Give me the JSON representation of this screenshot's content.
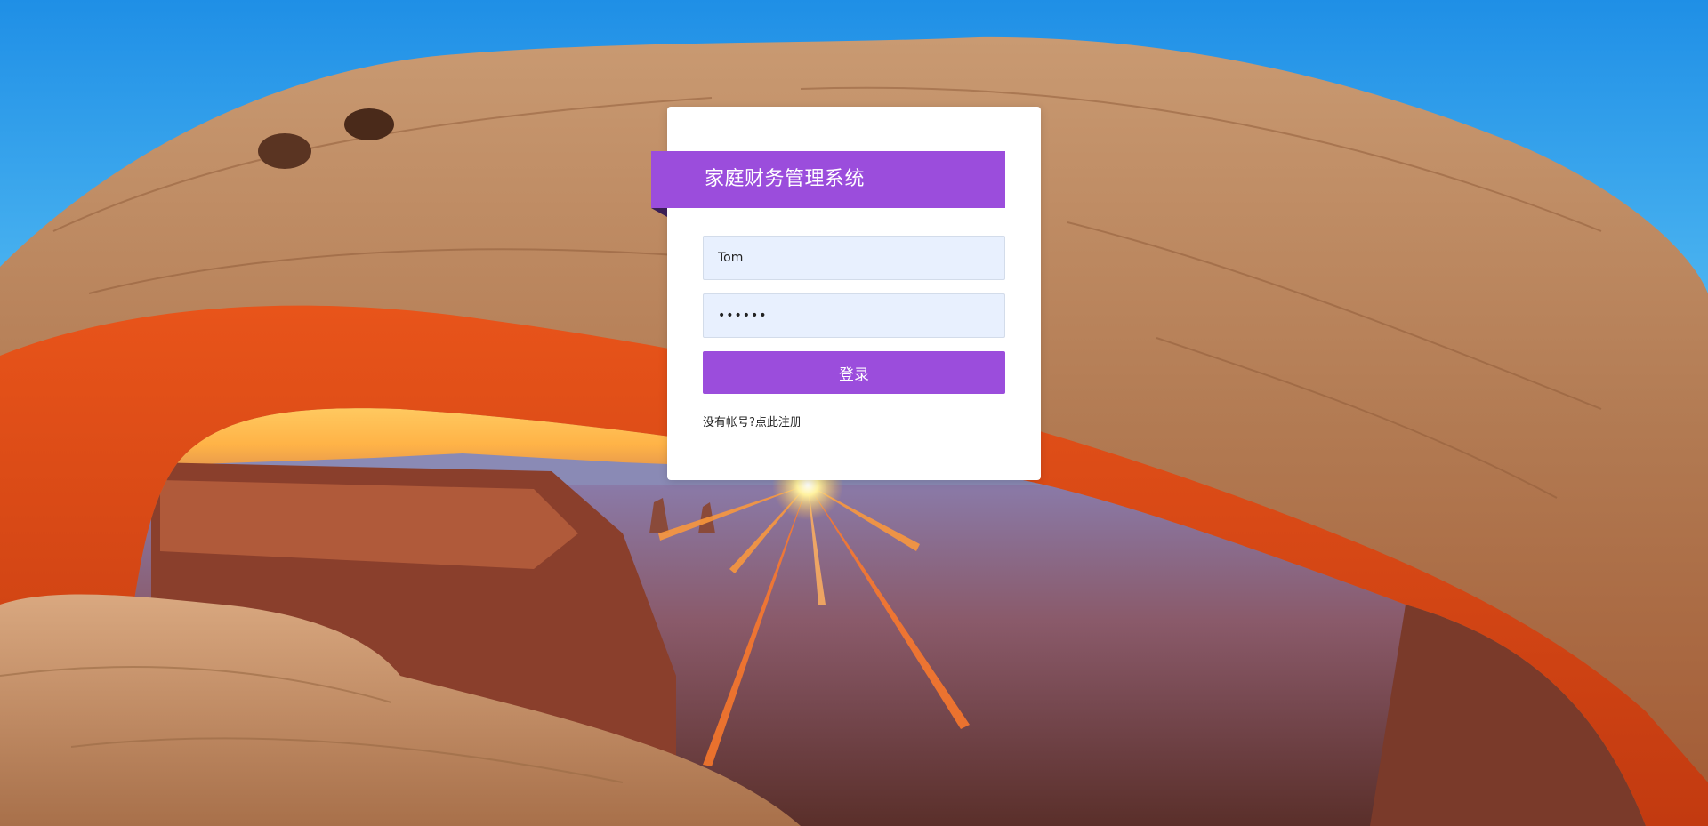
{
  "background": {
    "description_icon": "canyon-arch-sunrise-photo"
  },
  "login": {
    "title": "家庭财务管理系统",
    "username_value": "Tom",
    "password_value": "••••••",
    "submit_label": "登录",
    "register_prompt": "没有帐号?",
    "register_link": "点此注册"
  },
  "colors": {
    "accent": "#9b4ddc",
    "input_bg": "#e8f0fe"
  }
}
